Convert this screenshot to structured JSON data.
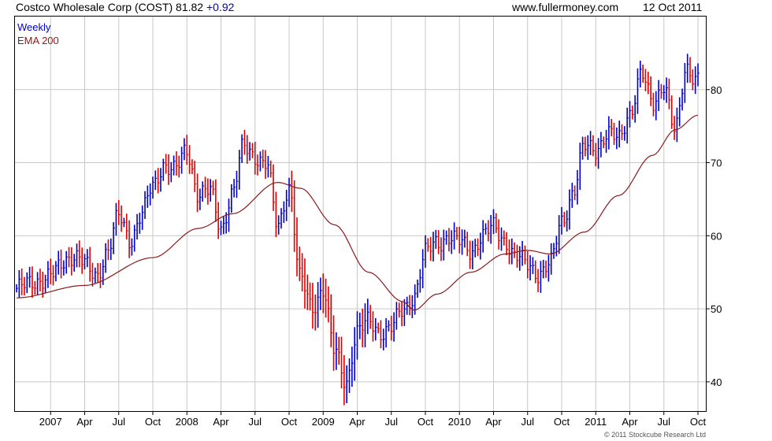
{
  "header": {
    "title": "Costco Wholesale Corp (COST) 81.82",
    "change": "+0.92",
    "site": "www.fullermoney.com",
    "date": "12 Oct 2011"
  },
  "copyright": "© 2011 Stockcube Research Ltd",
  "colors": {
    "up": "#0000cc",
    "down": "#dd0000",
    "ema": "#8b1a1a",
    "grid": "#c8c8c8"
  },
  "chart_data": {
    "type": "bar",
    "subtype": "weekly price bars with moving average",
    "legend": [
      {
        "label": "Weekly",
        "color": "#0000cc"
      },
      {
        "label": "EMA 200",
        "color": "#8b1a1a"
      }
    ],
    "x_tick_labels": [
      "2007",
      "Apr",
      "Jul",
      "Oct",
      "2008",
      "Apr",
      "Jul",
      "Oct",
      "2009",
      "Apr",
      "Jul",
      "Oct",
      "2010",
      "Apr",
      "Jul",
      "Oct",
      "2011",
      "Apr",
      "Jul",
      "Oct"
    ],
    "y_ticks": [
      40,
      50,
      60,
      70,
      80
    ],
    "ylim": [
      36,
      90
    ],
    "x_range": [
      "2006-10",
      "2011-10"
    ],
    "grid": true,
    "legend_position": "top-left",
    "price_anchors": [
      {
        "t": "2006-10",
        "v": 52.8
      },
      {
        "t": "2007-01",
        "v": 54.5
      },
      {
        "t": "2007-03",
        "v": 57.5
      },
      {
        "t": "2007-05",
        "v": 54.5
      },
      {
        "t": "2007-06",
        "v": 58
      },
      {
        "t": "2007-07",
        "v": 62.5
      },
      {
        "t": "2007-08",
        "v": 59.5
      },
      {
        "t": "2007-09",
        "v": 63
      },
      {
        "t": "2007-10",
        "v": 66.5
      },
      {
        "t": "2007-11",
        "v": 70
      },
      {
        "t": "2007-12",
        "v": 69
      },
      {
        "t": "2008-01",
        "v": 71.5
      },
      {
        "t": "2008-02",
        "v": 66
      },
      {
        "t": "2008-03",
        "v": 66
      },
      {
        "t": "2008-04",
        "v": 61
      },
      {
        "t": "2008-05",
        "v": 66
      },
      {
        "t": "2008-06",
        "v": 72
      },
      {
        "t": "2008-07",
        "v": 71
      },
      {
        "t": "2008-08",
        "v": 70
      },
      {
        "t": "2008-09",
        "v": 61
      },
      {
        "t": "2008-10",
        "v": 67
      },
      {
        "t": "2008-11",
        "v": 54
      },
      {
        "t": "2008-12",
        "v": 50
      },
      {
        "t": "2009-01",
        "v": 53
      },
      {
        "t": "2009-02",
        "v": 44
      },
      {
        "t": "2009-03",
        "v": 40
      },
      {
        "t": "2009-04",
        "v": 47
      },
      {
        "t": "2009-05",
        "v": 48
      },
      {
        "t": "2009-06",
        "v": 47
      },
      {
        "t": "2009-07",
        "v": 47.5
      },
      {
        "t": "2009-08",
        "v": 49.5
      },
      {
        "t": "2009-09",
        "v": 52
      },
      {
        "t": "2009-10",
        "v": 57.5
      },
      {
        "t": "2009-11",
        "v": 59
      },
      {
        "t": "2009-12",
        "v": 60
      },
      {
        "t": "2010-01",
        "v": 59
      },
      {
        "t": "2010-02",
        "v": 58
      },
      {
        "t": "2010-03",
        "v": 60
      },
      {
        "t": "2010-04",
        "v": 61
      },
      {
        "t": "2010-05",
        "v": 59.5
      },
      {
        "t": "2010-06",
        "v": 57
      },
      {
        "t": "2010-07",
        "v": 56
      },
      {
        "t": "2010-08",
        "v": 55
      },
      {
        "t": "2010-09",
        "v": 56
      },
      {
        "t": "2010-10",
        "v": 62
      },
      {
        "t": "2010-11",
        "v": 66
      },
      {
        "t": "2010-12",
        "v": 72
      },
      {
        "t": "2011-01",
        "v": 72
      },
      {
        "t": "2011-02",
        "v": 74
      },
      {
        "t": "2011-03",
        "v": 73
      },
      {
        "t": "2011-04",
        "v": 77
      },
      {
        "t": "2011-05",
        "v": 82
      },
      {
        "t": "2011-06",
        "v": 78
      },
      {
        "t": "2011-07",
        "v": 81
      },
      {
        "t": "2011-08",
        "v": 74
      },
      {
        "t": "2011-09",
        "v": 83
      },
      {
        "t": "2011-10",
        "v": 81.8
      }
    ],
    "ema_anchors": [
      {
        "t": "2006-10",
        "v": 51.5
      },
      {
        "t": "2007-04",
        "v": 53.2
      },
      {
        "t": "2007-10",
        "v": 57
      },
      {
        "t": "2008-02",
        "v": 61
      },
      {
        "t": "2008-05",
        "v": 63
      },
      {
        "t": "2008-09",
        "v": 67.3
      },
      {
        "t": "2008-11",
        "v": 66.5
      },
      {
        "t": "2009-02",
        "v": 61.5
      },
      {
        "t": "2009-05",
        "v": 55
      },
      {
        "t": "2009-08",
        "v": 51
      },
      {
        "t": "2009-09",
        "v": 49.8
      },
      {
        "t": "2009-11",
        "v": 52
      },
      {
        "t": "2010-02",
        "v": 55
      },
      {
        "t": "2010-05",
        "v": 57.5
      },
      {
        "t": "2010-07",
        "v": 58
      },
      {
        "t": "2010-09",
        "v": 57.5
      },
      {
        "t": "2010-12",
        "v": 60.5
      },
      {
        "t": "2011-03",
        "v": 65.5
      },
      {
        "t": "2011-06",
        "v": 71
      },
      {
        "t": "2011-08",
        "v": 74.5
      },
      {
        "t": "2011-10",
        "v": 76.5
      }
    ]
  }
}
